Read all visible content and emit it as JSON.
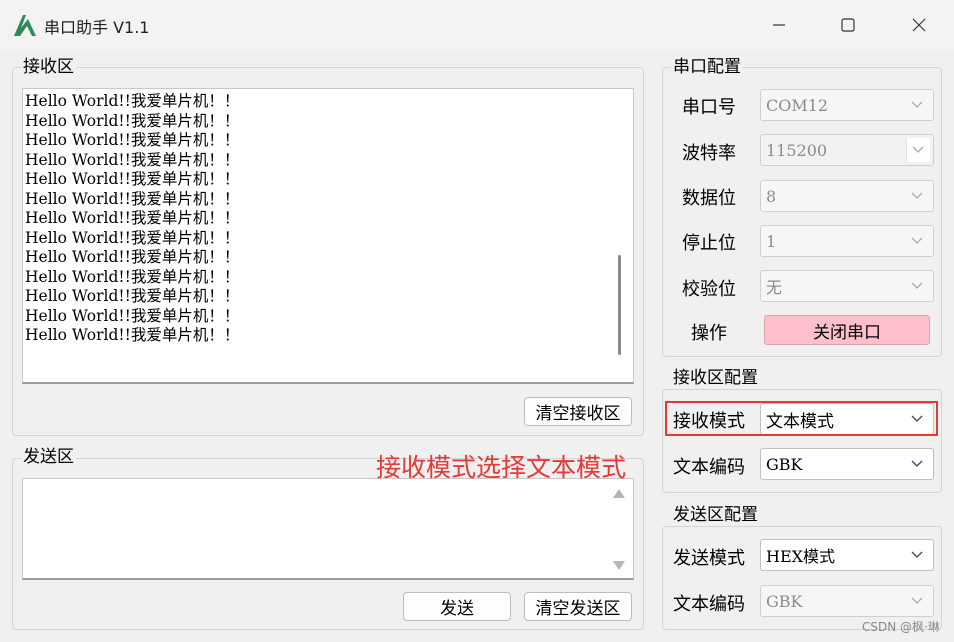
{
  "window": {
    "title": "串口助手 V1.1",
    "accent_color": "#2e8b57",
    "controls": [
      "minimize-icon",
      "maximize-icon",
      "close-icon"
    ]
  },
  "receive": {
    "title": "接收区",
    "lines": [
      "Hello World!!我爱单片机！！",
      "Hello World!!我爱单片机！！",
      "Hello World!!我爱单片机！！",
      "Hello World!!我爱单片机！！",
      "Hello World!!我爱单片机！！",
      "Hello World!!我爱单片机！！",
      "Hello World!!我爱单片机！！",
      "Hello World!!我爱单片机！！",
      "Hello World!!我爱单片机！！",
      "Hello World!!我爱单片机！！",
      "Hello World!!我爱单片机！！",
      "Hello World!!我爱单片机！！",
      "Hello World!!我爱单片机！！"
    ],
    "clear_button": "清空接收区"
  },
  "send": {
    "title": "发送区",
    "value": "",
    "send_button": "发送",
    "clear_button": "清空发送区"
  },
  "serial_config": {
    "title": "串口配置",
    "port_label": "串口号",
    "port_value": "COM12",
    "baud_label": "波特率",
    "baud_value": "115200",
    "databits_label": "数据位",
    "databits_value": "8",
    "stopbits_label": "停止位",
    "stopbits_value": "1",
    "parity_label": "校验位",
    "parity_value": "无",
    "action_label": "操作",
    "action_button": "关闭串口",
    "action_button_color": "#ffc0cb"
  },
  "receive_config": {
    "title": "接收区配置",
    "mode_label": "接收模式",
    "mode_value": "文本模式",
    "encoding_label": "文本编码",
    "encoding_value": "GBK"
  },
  "send_config": {
    "title": "发送区配置",
    "mode_label": "发送模式",
    "mode_value": "HEX模式",
    "encoding_label": "文本编码",
    "encoding_value": "GBK"
  },
  "annotation": {
    "text": "接收模式选择文本模式",
    "color": "#e53935"
  },
  "watermark": "CSDN @枫·琳"
}
